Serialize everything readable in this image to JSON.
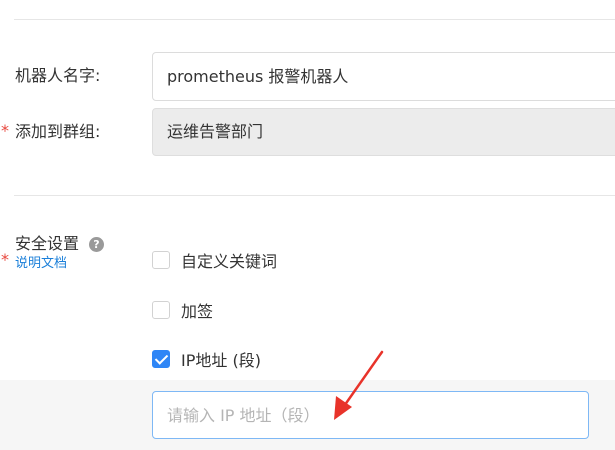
{
  "form": {
    "robot_name_label": "机器人名字:",
    "robot_name_value": "prometheus 报警机器人",
    "group_label": "添加到群组:",
    "group_value": "运维告警部门",
    "required_mark": "*"
  },
  "security": {
    "label": "安全设置",
    "help_icon": "?",
    "doc_link": "说明文档",
    "options": [
      {
        "label": "自定义关键词",
        "checked": false
      },
      {
        "label": "加签",
        "checked": false
      },
      {
        "label": "IP地址 (段)",
        "checked": true
      }
    ],
    "ip_placeholder": "请输入 IP 地址（段）"
  },
  "annotation": {
    "arrow_icon": "red-arrow-icon",
    "arrow_color": "#e8332a"
  },
  "colors": {
    "accent": "#2f86f6",
    "required": "#e8473d",
    "link": "#1a7fd9"
  }
}
